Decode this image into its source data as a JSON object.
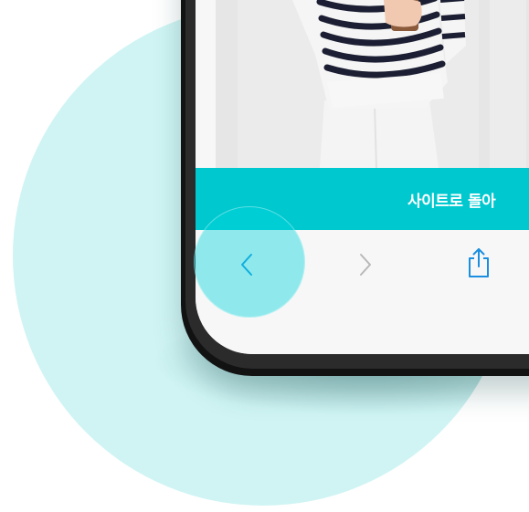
{
  "banner": {
    "text": "사이트로 돌아"
  },
  "toolbar": {
    "back_icon": "chevron-left-icon",
    "forward_icon": "chevron-right-icon",
    "share_icon": "share-icon"
  },
  "colors": {
    "background_circle": "#d0f4f4",
    "banner": "#00c8cf",
    "accent_icon": "#1a8fe0",
    "disabled_icon": "#b8b8b8",
    "highlight": "#00d7de"
  }
}
